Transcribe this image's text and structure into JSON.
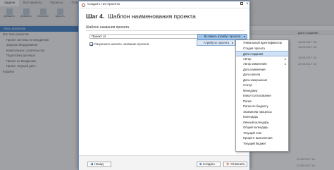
{
  "background": {
    "tabs": [
      "Задачи",
      "Все проекты",
      "Проекты",
      "Отчёты"
    ],
    "toolbar_buttons": [
      "Добавить",
      "Добавить",
      "Изменить",
      "Удалить"
    ],
    "sidebar_header": "Типы проектов",
    "tree_items": [
      "Все типы проектов",
      "Проект системы по внедрению",
      "Закупка оборудования",
      "Капитальное строительство",
      "Подготовка договора",
      "Проект по внедрению",
      "Проект текущей деят...",
      "Корзина"
    ],
    "grid_header": [
      "Дата создания"
    ],
    "dates": [
      "15.05.2017 15:",
      "15.05.2017 15:",
      "19.05.2017 15:",
      "22.05.2017 15:"
    ],
    "footer_dates": [
      "22.05.2017 10:",
      "22.05.2017 10:"
    ]
  },
  "dialog": {
    "title": "Создать тип проекта",
    "step_prefix": "Шаг 4.",
    "step_title": "Шаблон наименования проекта",
    "section_label": "Шаблон названия проекта",
    "name_value": "Проект от",
    "insert_attribute_label": "Вставить атрибут проекта",
    "allow_rename_label": "Разрешить менять название проекта",
    "back_label": "Назад",
    "create_label": "Создать",
    "cancel_label": "Отменить"
  },
  "submenu": {
    "label": "Атрибуты проекта"
  },
  "dropdown": {
    "items": [
      {
        "label": "Уникальный идентификатор",
        "has_submenu": false,
        "selected": false
      },
      {
        "label": "Стадия проекта",
        "has_submenu": false,
        "selected": false
      },
      {
        "label": "Дата создания",
        "has_submenu": false,
        "selected": true
      },
      {
        "label": "Автор",
        "has_submenu": true,
        "selected": false
      },
      {
        "label": "Автор изменения",
        "has_submenu": true,
        "selected": false
      },
      {
        "label": "Дата изменения",
        "has_submenu": false,
        "selected": false
      },
      {
        "label": "Дата начала",
        "has_submenu": false,
        "selected": false
      },
      {
        "label": "Дата завершения",
        "has_submenu": false,
        "selected": false
      },
      {
        "label": "Статус",
        "has_submenu": false,
        "selected": false
      },
      {
        "label": "Менеджер",
        "has_submenu": false,
        "selected": false
      },
      {
        "label": "Канал согласования",
        "has_submenu": false,
        "selected": false
      },
      {
        "label": "Папка",
        "has_submenu": false,
        "selected": false
      },
      {
        "label": "Папка по бюджету",
        "has_submenu": false,
        "selected": false
      },
      {
        "label": "Экземпляр процесса",
        "has_submenu": false,
        "selected": false
      },
      {
        "label": "Календарь",
        "has_submenu": false,
        "selected": false
      },
      {
        "label": "Личный календарь",
        "has_submenu": false,
        "selected": false
      },
      {
        "label": "Общий календарь",
        "has_submenu": false,
        "selected": false
      },
      {
        "label": "Текущий этап",
        "has_submenu": false,
        "selected": false
      },
      {
        "label": "Процент выполнения",
        "has_submenu": false,
        "selected": false
      },
      {
        "label": "Текущий бюджет",
        "has_submenu": false,
        "selected": false
      }
    ]
  },
  "colors": {
    "accent": "#3d7fc4",
    "button_active": "#a3c4e8",
    "selected_item": "#cfe1f5"
  }
}
